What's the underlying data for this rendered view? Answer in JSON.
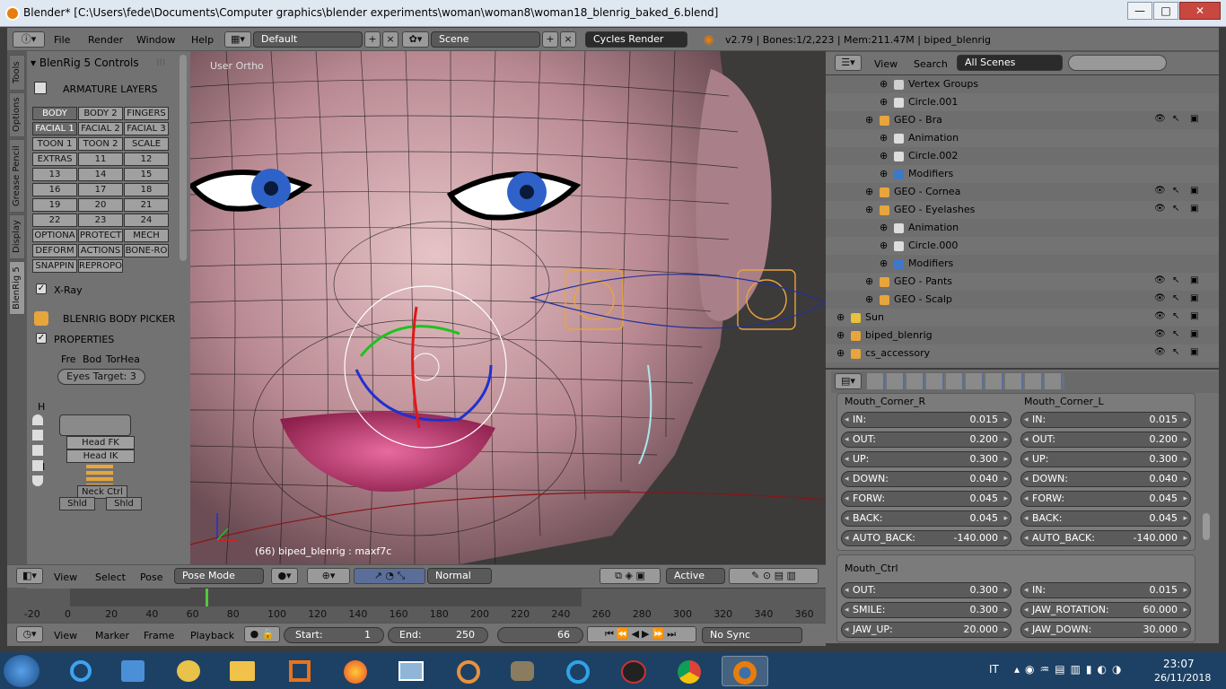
{
  "window": {
    "title": "Blender* [C:\\Users\\fede\\Documents\\Computer graphics\\blender experiments\\woman\\woman8\\woman18_blenrig_baked_6.blend]",
    "min_label": "—",
    "max_label": "□",
    "close_label": "✕"
  },
  "menubar": {
    "items": [
      "File",
      "Render",
      "Window",
      "Help"
    ],
    "layout": "Default",
    "scene": "Scene",
    "engine": "Cycles Render",
    "stats": "v2.79 | Bones:1/2,223 | Mem:211.47M | biped_blenrig"
  },
  "tools": {
    "tabs": [
      "Tools",
      "Options",
      "Grease Pencil",
      "Display",
      "BlenRig 5"
    ],
    "panel_title": "BlenRig 5 Controls",
    "armature_title": "ARMATURE LAYERS",
    "layers": [
      [
        "BODY",
        "BODY 2",
        "FINGERS"
      ],
      [
        "FACIAL 1",
        "FACIAL 2",
        "FACIAL 3"
      ],
      [
        "TOON 1",
        "TOON 2",
        "SCALE"
      ],
      [
        "EXTRAS",
        "11",
        "12"
      ],
      [
        "13",
        "14",
        "15"
      ],
      [
        "16",
        "17",
        "18"
      ],
      [
        "19",
        "20",
        "21"
      ],
      [
        "22",
        "23",
        "24"
      ],
      [
        "OPTIONA",
        "PROTECT",
        "MECH"
      ],
      [
        "DEFORM",
        "ACTIONS",
        "BONE-RO"
      ],
      [
        "SNAPPIN",
        "REPROPO",
        ""
      ]
    ],
    "xray": "X-Ray",
    "picker": "BLENRIG BODY PICKER",
    "properties": "PROPERTIES",
    "tabs3": [
      "Fre",
      "Bod",
      "TorHea"
    ],
    "eyes_target": "Eyes Target:  3",
    "picker_h": "H",
    "picker_n": "N",
    "head_fk": "Head FK",
    "head_ik": "Head IK",
    "neck_ctrl": "Neck Ctrl",
    "shld_l": "Shld",
    "shld_r": "Shld"
  },
  "viewport": {
    "top_label": "User Ortho",
    "bottom_label": "(66) biped_blenrig : maxf7c"
  },
  "viewport_header": {
    "view": "View",
    "select": "Select",
    "pose": "Pose",
    "mode": "Pose Mode",
    "orientation": "Normal",
    "pivot": "Active"
  },
  "outliner": {
    "view": "View",
    "search": "Search",
    "filter": "All Scenes",
    "rows": [
      {
        "name": "Vertex Groups",
        "indent": 5,
        "icon": "vertex-groups",
        "color": "#cfcfcf",
        "vis": false
      },
      {
        "name": "Circle.001",
        "indent": 5,
        "icon": "mesh",
        "color": "#dddddd",
        "vis": false
      },
      {
        "name": "GEO - Bra",
        "indent": 4,
        "icon": "mesh-object",
        "color": "#e8a53c",
        "vis": true
      },
      {
        "name": "Animation",
        "indent": 5,
        "icon": "animation",
        "color": "#dddddd",
        "vis": false
      },
      {
        "name": "Circle.002",
        "indent": 5,
        "icon": "mesh",
        "color": "#dddddd",
        "vis": false
      },
      {
        "name": "Modifiers",
        "indent": 5,
        "icon": "wrench",
        "color": "#3f78c7",
        "vis": false
      },
      {
        "name": "GEO - Cornea",
        "indent": 4,
        "icon": "mesh-object",
        "color": "#e8a53c",
        "vis": true
      },
      {
        "name": "GEO - Eyelashes",
        "indent": 4,
        "icon": "mesh-object",
        "color": "#e8a53c",
        "vis": true
      },
      {
        "name": "Animation",
        "indent": 5,
        "icon": "animation",
        "color": "#dddddd",
        "vis": false
      },
      {
        "name": "Circle.000",
        "indent": 5,
        "icon": "mesh",
        "color": "#dddddd",
        "vis": false
      },
      {
        "name": "Modifiers",
        "indent": 5,
        "icon": "wrench",
        "color": "#3f78c7",
        "vis": false
      },
      {
        "name": "GEO - Pants",
        "indent": 4,
        "icon": "mesh-object",
        "color": "#e8a53c",
        "vis": true
      },
      {
        "name": "GEO - Scalp",
        "indent": 4,
        "icon": "mesh-object",
        "color": "#e8a53c",
        "vis": true
      },
      {
        "name": "Sun",
        "indent": 2,
        "icon": "lamp",
        "color": "#e8c23c",
        "vis": true
      },
      {
        "name": "biped_blenrig",
        "indent": 2,
        "icon": "armature",
        "color": "#e8a53c",
        "vis": true
      },
      {
        "name": "cs_accessory",
        "indent": 2,
        "icon": "empty",
        "color": "#e8a53c",
        "vis": true
      }
    ]
  },
  "props": {
    "group1": {
      "left_title": "Mouth_Corner_R",
      "right_title": "Mouth_Corner_L",
      "left": [
        {
          "label": "IN:",
          "value": "0.015"
        },
        {
          "label": "OUT:",
          "value": "0.200"
        },
        {
          "label": "UP:",
          "value": "0.300"
        },
        {
          "label": "DOWN:",
          "value": "0.040"
        },
        {
          "label": "FORW:",
          "value": "0.045"
        },
        {
          "label": "BACK:",
          "value": "0.045"
        },
        {
          "label": "AUTO_BACK:",
          "value": "-140.000"
        }
      ],
      "right": [
        {
          "label": "IN:",
          "value": "0.015"
        },
        {
          "label": "OUT:",
          "value": "0.200"
        },
        {
          "label": "UP:",
          "value": "0.300"
        },
        {
          "label": "DOWN:",
          "value": "0.040"
        },
        {
          "label": "FORW:",
          "value": "0.045"
        },
        {
          "label": "BACK:",
          "value": "0.045"
        },
        {
          "label": "AUTO_BACK:",
          "value": "-140.000"
        }
      ]
    },
    "group2": {
      "title": "Mouth_Ctrl",
      "left": [
        {
          "label": "OUT:",
          "value": "0.300"
        },
        {
          "label": "SMILE:",
          "value": "0.300"
        },
        {
          "label": "JAW_UP:",
          "value": "20.000"
        }
      ],
      "right": [
        {
          "label": "IN:",
          "value": "0.015"
        },
        {
          "label": "JAW_ROTATION:",
          "value": "60.000"
        },
        {
          "label": "JAW_DOWN:",
          "value": "30.000"
        }
      ]
    }
  },
  "timeline": {
    "ticks": [
      "-20",
      "0",
      "20",
      "40",
      "60",
      "80",
      "100",
      "120",
      "140",
      "160",
      "180",
      "200",
      "220",
      "240",
      "260",
      "280",
      "300",
      "320",
      "340",
      "360"
    ],
    "current_frame": 66,
    "view": "View",
    "marker": "Marker",
    "frame": "Frame",
    "playback": "Playback",
    "start_label": "Start:",
    "start": "1",
    "end_label": "End:",
    "end": "250",
    "current": "66",
    "sync": "No Sync"
  },
  "taskbar": {
    "lang": "IT",
    "time": "23:07",
    "date": "26/11/2018"
  },
  "colors": {
    "accent": "#e87d0d",
    "ui_gray": "#727272",
    "skin": "#c99aa0",
    "lips": "#c2376f",
    "iris": "#2f62c8",
    "taskbar": "#1d4164"
  }
}
